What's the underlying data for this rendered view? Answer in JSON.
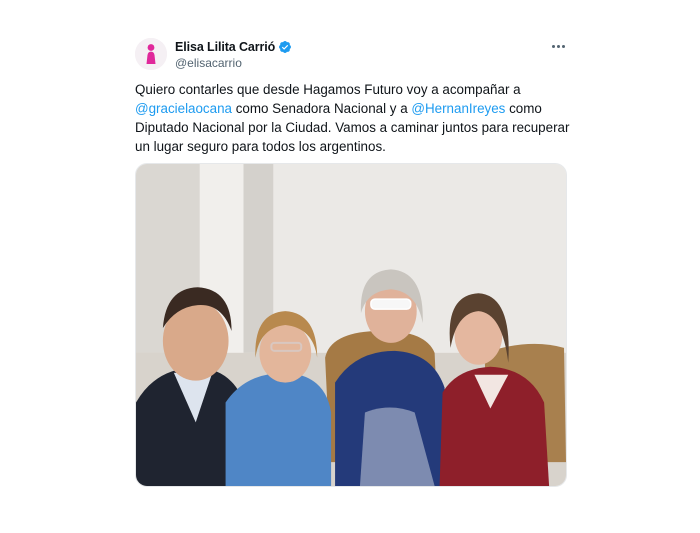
{
  "author": {
    "display_name": "Elisa Lilita Carrió",
    "handle": "@elisacarrio",
    "verified": true,
    "avatar_icon": "person-silhouette-icon",
    "avatar_color": "#e0289b"
  },
  "more_icon": "more-horizontal-icon",
  "tweet": {
    "text_1": "Quiero contarles que desde Hagamos Futuro voy a acompañar a ",
    "mention_1": "@gracielaocana",
    "text_2": " como Senadora Nacional y a ",
    "mention_2": "@HernanIreyes",
    "text_3": " como Diputado Nacional por la Ciudad. Vamos a caminar juntos para recuperar un lugar seguro para todos los argentinos."
  },
  "colors": {
    "accent": "#1d9bf0",
    "text": "#0f1419",
    "secondary_text": "#536471"
  }
}
